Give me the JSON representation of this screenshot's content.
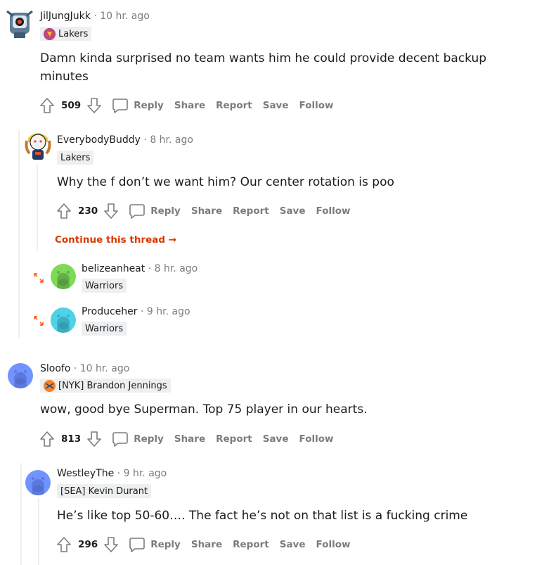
{
  "comments": [
    {
      "username": "JilJungJukk",
      "time": "10 hr. ago",
      "flair": "Lakers",
      "body": "Damn kinda surprised no team wants him he could provide decent backup minutes",
      "votes": "509",
      "actions": [
        "Reply",
        "Share",
        "Report",
        "Save",
        "Follow"
      ]
    },
    {
      "username": "EverybodyBuddy",
      "time": "8 hr. ago",
      "flair": "Lakers",
      "body": "Why the f don’t we want him? Our center rotation is poo",
      "votes": "230",
      "actions": [
        "Reply",
        "Share",
        "Report",
        "Save",
        "Follow"
      ],
      "continue_thread": "Continue this thread"
    },
    {
      "username": "belizeanheat",
      "time": "8 hr. ago",
      "flair": "Warriors"
    },
    {
      "username": "Produceher",
      "time": "9 hr. ago",
      "flair": "Warriors"
    },
    {
      "username": "Sloofo",
      "time": "10 hr. ago",
      "flair": "[NYK] Brandon Jennings",
      "body": "wow, good bye Superman. Top 75 player in our hearts.",
      "votes": "813",
      "actions": [
        "Reply",
        "Share",
        "Report",
        "Save",
        "Follow"
      ]
    },
    {
      "username": "WestleyThe",
      "time": "9 hr. ago",
      "flair": "[SEA] Kevin Durant",
      "body": "He’s like top 50-60…. The fact he’s not on that list is a fucking crime",
      "votes": "296",
      "actions": [
        "Reply",
        "Share",
        "Report",
        "Save",
        "Follow"
      ]
    }
  ],
  "separator": "·",
  "colors": {
    "accent": "#d93a00",
    "muted": "#7c7c7c",
    "flair_bg": "#edeff1",
    "avatar_green": "#7ed957",
    "avatar_cyan": "#4fd1e8",
    "avatar_blue": "#7193ff"
  },
  "icons": {
    "upvote": "upvote-icon",
    "downvote": "downvote-icon",
    "reply": "comment-bubble-icon",
    "expand": "expand-arrows-icon",
    "continue": "arrow-right-icon"
  }
}
